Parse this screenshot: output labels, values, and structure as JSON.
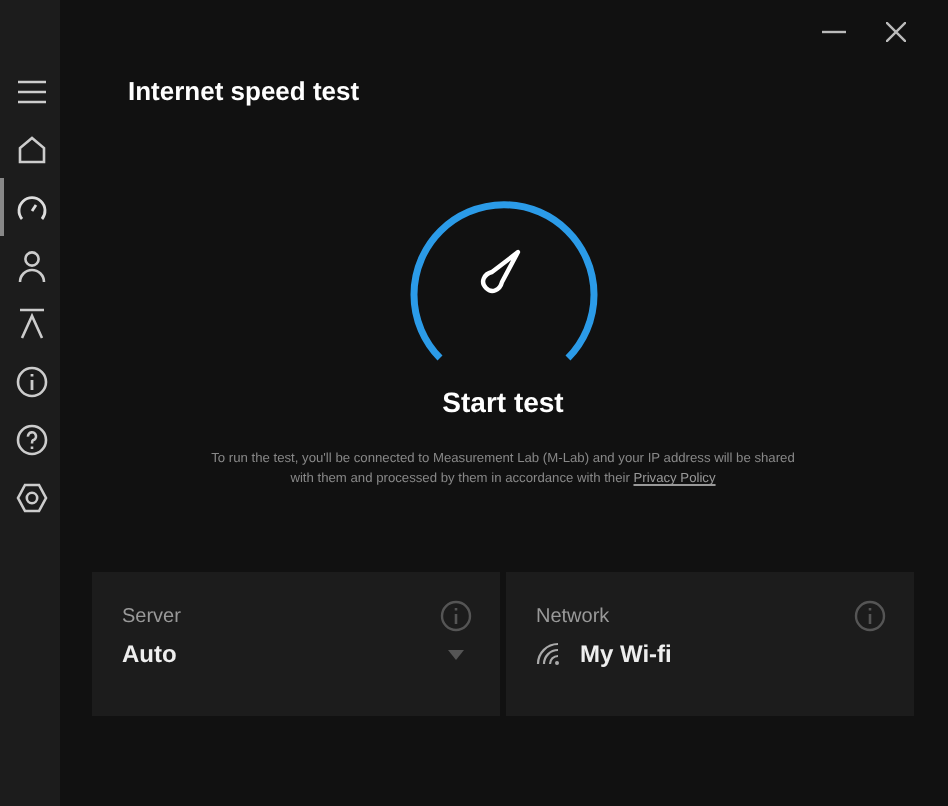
{
  "sidebar": {
    "items": [
      {
        "kind": "menu",
        "selected": false
      },
      {
        "kind": "home",
        "selected": false
      },
      {
        "kind": "speed",
        "selected": true
      },
      {
        "kind": "person",
        "selected": false
      },
      {
        "kind": "upload",
        "selected": false
      },
      {
        "kind": "info",
        "selected": false
      },
      {
        "kind": "help",
        "selected": false
      },
      {
        "kind": "settings",
        "selected": false
      }
    ]
  },
  "title": "Internet speed test",
  "start_button": "Start test",
  "disclaimer": {
    "text": "To run the test, you'll be connected to Measurement Lab (M-Lab) and your IP address will be shared with them and processed by them in accordance with their",
    "link": "Privacy Policy"
  },
  "cards": [
    {
      "kind": "dropdown",
      "label": "Server",
      "value": "Auto"
    },
    {
      "kind": "network",
      "label": "Network",
      "value": "My Wi-fi"
    }
  ]
}
